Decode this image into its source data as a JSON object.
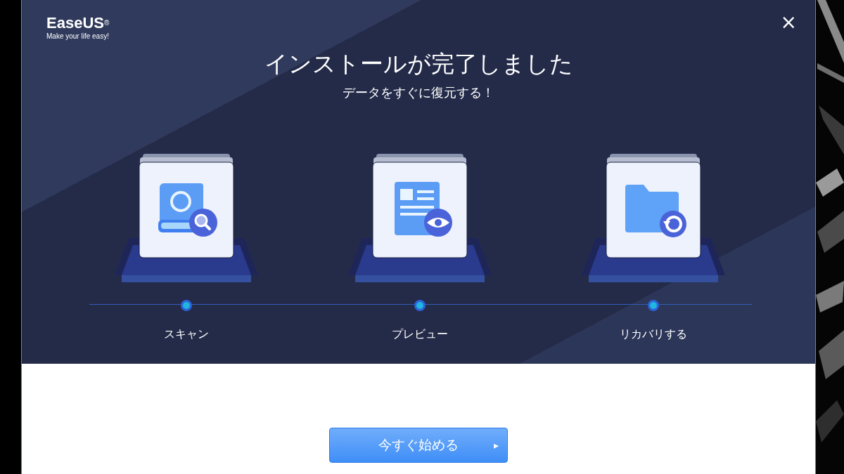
{
  "logo": {
    "name": "EaseUS",
    "mark": "®",
    "tagline": "Make your life easy!"
  },
  "close": "×",
  "title": "インストールが完了しました",
  "subtitle": "データをすぐに復元する！",
  "steps": [
    {
      "kind": "scan",
      "label": "スキャン"
    },
    {
      "kind": "preview",
      "label": "プレビュー"
    },
    {
      "kind": "recover",
      "label": "リカバリする"
    }
  ],
  "start_button": {
    "label": "今すぐ始める",
    "arrow": "▸"
  }
}
